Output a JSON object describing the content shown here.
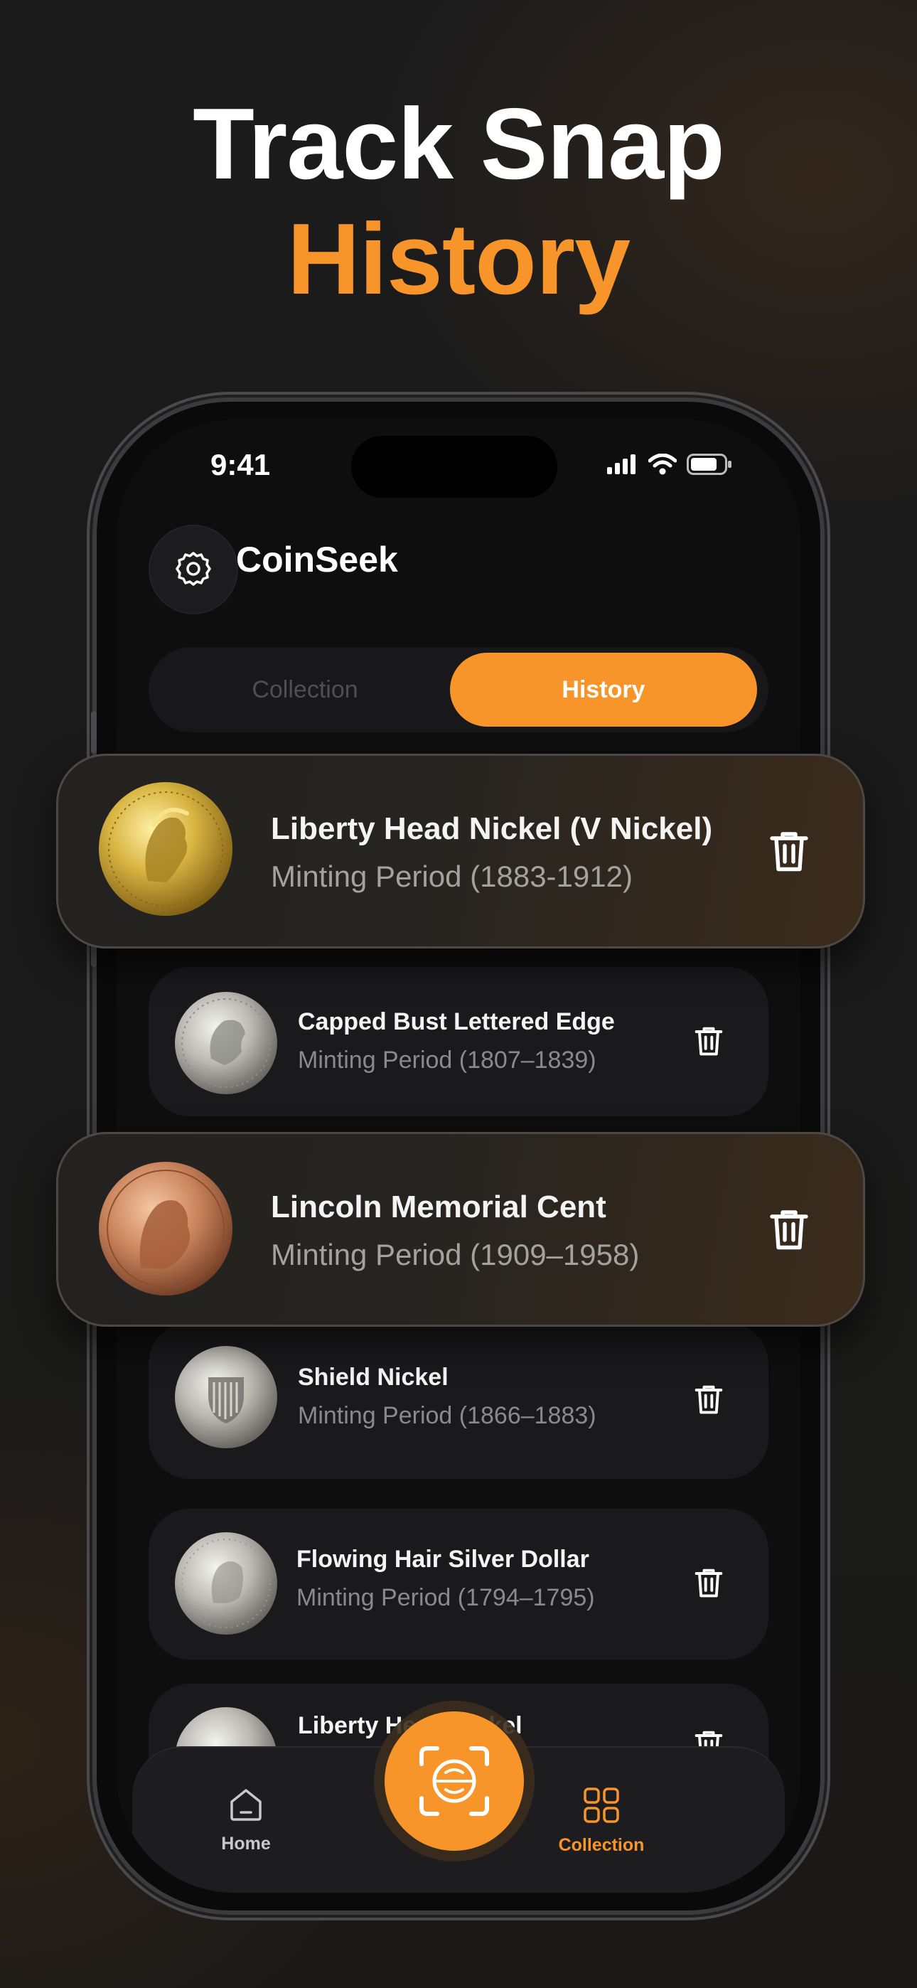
{
  "headline": {
    "line1": "Track Snap",
    "line2": "History"
  },
  "status_bar": {
    "time": "9:41"
  },
  "app": {
    "title": "CoinSeek"
  },
  "segmented": {
    "tab1": "Collection",
    "tab2": "History",
    "selected": "History"
  },
  "history_items": [
    {
      "title": "Liberty Head Nickel (V Nickel)",
      "subtitle": "Minting Period (1883-1912)",
      "coin": "gold-indian-head-coin",
      "highlighted": true
    },
    {
      "title": "Capped Bust Lettered Edge",
      "subtitle": "Minting Period (1807–1839)",
      "coin": "silver-capped-bust-coin"
    },
    {
      "title": "Lincoln Memorial Cent",
      "subtitle": "Minting Period (1909–1958)",
      "coin": "copper-lincoln-cent",
      "highlighted": true
    },
    {
      "title": "Shield Nickel",
      "subtitle": "Minting Period (1866–1883)",
      "coin": "silver-shield-nickel"
    },
    {
      "title": "Flowing Hair Silver Dollar",
      "subtitle": "Minting Period (1794–1795)",
      "coin": "silver-flowing-hair-dollar"
    },
    {
      "title": "Liberty Head Nickel",
      "subtitle": "",
      "coin": "silver-liberty-coin",
      "partially_hidden": true
    }
  ],
  "tabbar": {
    "home": "Home",
    "collection": "Collection",
    "active": "Collection"
  },
  "colors": {
    "accent": "#f7952a",
    "background": "#1b1b1c",
    "card": "#1a1a1c",
    "text_secondary": "#8a8a8e"
  },
  "icons": [
    "gear-icon",
    "trash-icon",
    "home-icon",
    "grid-icon",
    "coin-scan-icon",
    "signal-icon",
    "wifi-icon",
    "battery-icon"
  ]
}
